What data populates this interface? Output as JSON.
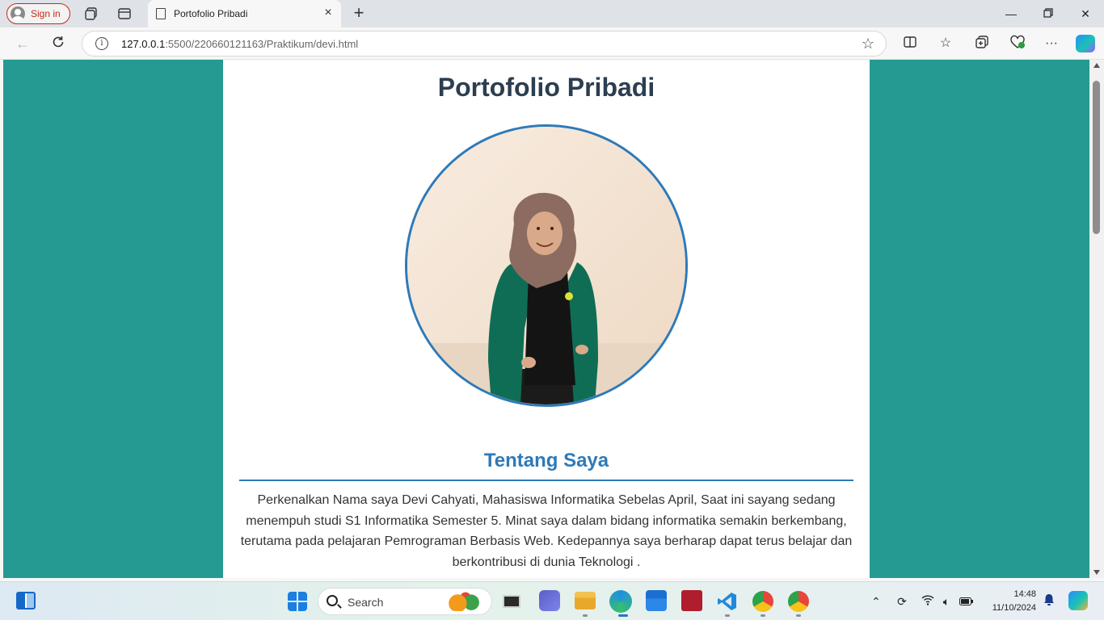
{
  "browser": {
    "signin_label": "Sign in",
    "tab_title": "Portofolio Pribadi",
    "url_host": "127.0.0.1",
    "url_rest": ":5500/220660121163/Praktikum/devi.html"
  },
  "page": {
    "title": "Portofolio Pribadi",
    "about_heading": "Tentang Saya",
    "about_text": "Perkenalkan Nama saya Devi Cahyati, Mahasiswa Informatika Sebelas April, Saat ini sayang sedang menempuh studi S1 Informatika Semester 5. Minat saya dalam bidang informatika semakin berkembang, terutama pada pelajaran Pemrograman Berbasis Web. Kedepannya saya berharap dapat terus belajar dan berkontribusi di dunia Teknologi .",
    "colors": {
      "background": "#259a92",
      "panel": "#ffffff",
      "accent": "#2e7ab8",
      "title": "#2c3e50"
    }
  },
  "taskbar": {
    "search_label": "Search",
    "time": "14:48",
    "date": "11/10/2024"
  }
}
